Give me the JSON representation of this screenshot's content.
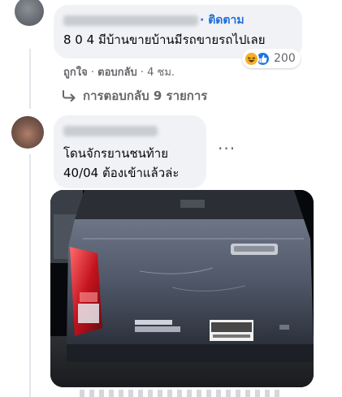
{
  "comment1": {
    "follow_label": "· ติดตาม",
    "text": "8 0 4 มีบ้านขายบ้านมีรถขายรถไปเลย",
    "reactions": {
      "icons": [
        "haha-icon",
        "like-icon"
      ],
      "count": "200"
    },
    "actions": {
      "like": "ถูกใจ",
      "reply": "ตอบกลับ",
      "time": "4 ชม."
    },
    "view_replies": "การตอบกลับ 9 รายการ"
  },
  "comment2": {
    "text_line1": "โดนจักรยานชนท้าย",
    "text_line2": "40/04 ต้องเข้าแล้วล่ะ",
    "photo": {
      "subject": "dark gray pickup truck rear at night",
      "badge": "D-MAX",
      "plate": "6กน 4040"
    }
  },
  "colors": {
    "bubble": "#f0f2f5",
    "link": "#216fdb",
    "secondary_text": "#65676b"
  }
}
